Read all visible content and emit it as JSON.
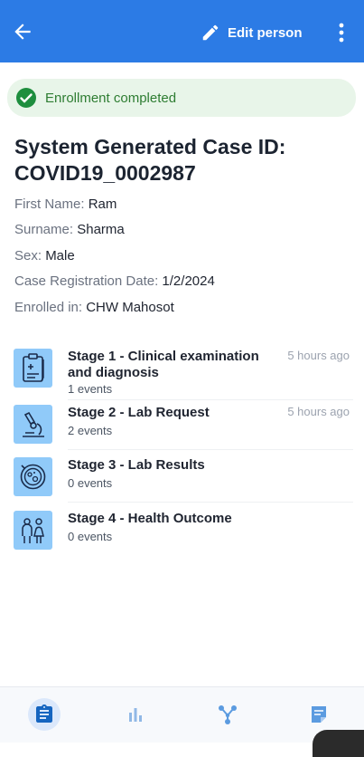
{
  "header": {
    "edit_label": "Edit person",
    "bar_color": "#2c7be5"
  },
  "banner": {
    "text": "Enrollment completed",
    "color": "#2e7d32"
  },
  "case": {
    "title_line1": "System Generated Case ID:",
    "title_line2": "COVID19_0002987"
  },
  "attributes": [
    {
      "label": "First Name:",
      "value": "Ram"
    },
    {
      "label": "Surname:",
      "value": "Sharma"
    },
    {
      "label": "Sex:",
      "value": "Male"
    },
    {
      "label": "Case Registration Date:",
      "value": "1/2/2024"
    },
    {
      "label": "Enrolled in:",
      "value": "CHW Mahosot"
    }
  ],
  "stages": [
    {
      "name": "Stage 1 - Clinical examination and diagnosis",
      "count": "1 events",
      "time": "5 hours ago",
      "icon": "clipboard-medical-icon"
    },
    {
      "name": "Stage 2 - Lab Request",
      "count": "2 events",
      "time": "5 hours ago",
      "icon": "microscope-icon"
    },
    {
      "name": "Stage 3 - Lab Results",
      "count": "0 events",
      "time": "",
      "icon": "petri-dish-icon"
    },
    {
      "name": "Stage 4 - Health Outcome",
      "count": "0 events",
      "time": "",
      "icon": "family-icon"
    }
  ],
  "bottom_nav": [
    {
      "name": "details-tab",
      "icon": "clipboard-icon",
      "active": true
    },
    {
      "name": "analytics-tab",
      "icon": "bar-chart-icon",
      "active": false
    },
    {
      "name": "relationships-tab",
      "icon": "relationships-icon",
      "active": false
    },
    {
      "name": "notes-tab",
      "icon": "note-icon",
      "active": false
    }
  ]
}
